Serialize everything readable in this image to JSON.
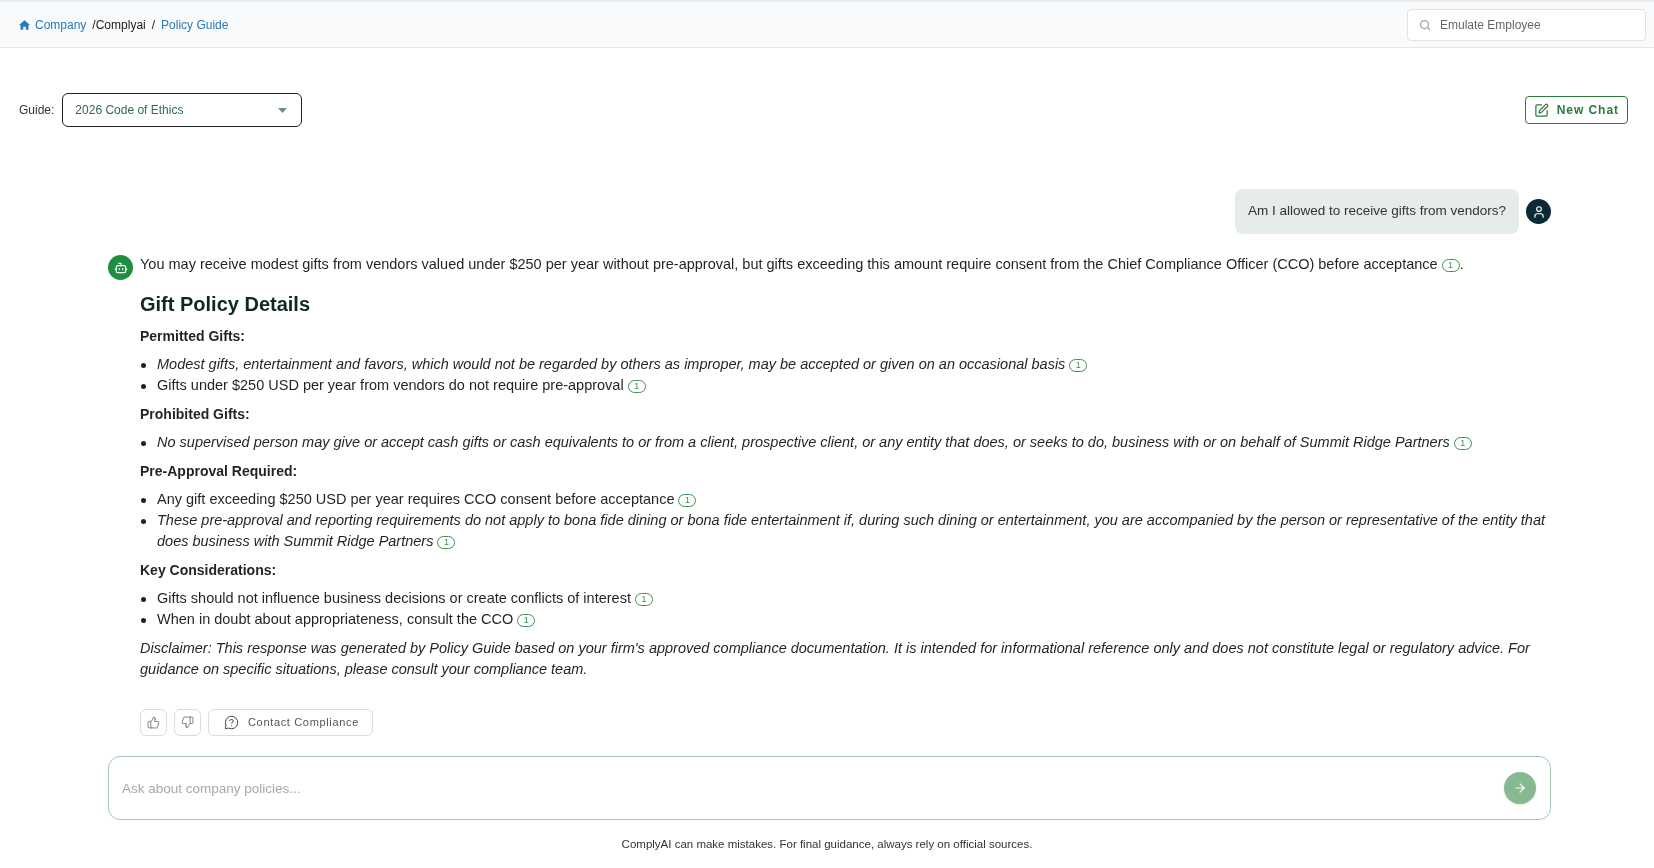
{
  "breadcrumb": [
    {
      "kind": "home",
      "label": "Company"
    },
    {
      "kind": "separator",
      "label": "/"
    },
    {
      "kind": "current",
      "label": "Complyai"
    },
    {
      "kind": "separator",
      "label": "/"
    },
    {
      "kind": "link",
      "label": "Policy Guide"
    }
  ],
  "search": {
    "placeholder": "Emulate Employee"
  },
  "guide": {
    "label": "Guide:",
    "value": "2026 Code of Ethics"
  },
  "new_chat_button": {
    "label": "New Chat"
  },
  "conversation": [
    {
      "kind": "user",
      "text": "Am I allowed to receive gifts from vendors?"
    },
    {
      "kind": "assistant",
      "summary": {
        "text": "You may receive modest gifts from vendors valued under $250 per year without pre-approval, but gifts exceeding this amount require consent from the Chief Compliance Officer (CCO) before acceptance",
        "citation": "1",
        "after": "."
      },
      "heading": "Gift Policy Details",
      "sections": [
        {
          "title": "Permitted Gifts:",
          "items": [
            {
              "text": "Modest gifts, entertainment and favors, which would not be regarded by others as improper, may be accepted or given on an occasional basis",
              "italic": true,
              "citation": "1"
            },
            {
              "text": "Gifts under $250 USD per year from vendors do not require pre-approval",
              "italic": false,
              "citation": "1"
            }
          ]
        },
        {
          "title": "Prohibited Gifts:",
          "items": [
            {
              "text": "No supervised person may give or accept cash gifts or cash equivalents to or from a client, prospective client, or any entity that does, or seeks to do, business with or on behalf of Summit Ridge Partners",
              "italic": true,
              "citation": "1"
            }
          ]
        },
        {
          "title": "Pre-Approval Required:",
          "items": [
            {
              "text": "Any gift exceeding $250 USD per year requires CCO consent before acceptance",
              "italic": false,
              "citation": "1"
            },
            {
              "text": "These pre-approval and reporting requirements do not apply to bona fide dining or bona fide entertainment if, during such dining or entertainment, you are accompanied by the person or representative of the entity that does business with Summit Ridge Partners",
              "italic": true,
              "citation": "1"
            }
          ]
        },
        {
          "title": "Key Considerations:",
          "items": [
            {
              "text": "Gifts should not influence business decisions or create conflicts of interest",
              "italic": false,
              "citation": "1"
            },
            {
              "text": "When in doubt about appropriateness, consult the CCO",
              "italic": false,
              "citation": "1"
            }
          ]
        }
      ],
      "disclaimer": "Disclaimer: This response was generated by Policy Guide based on your firm's approved compliance documentation. It is intended for informational reference only and does not constitute legal or regulatory advice. For guidance on specific situations, please consult your compliance team.",
      "actions": [
        {
          "kind": "like"
        },
        {
          "kind": "dislike"
        },
        {
          "kind": "contact",
          "label": "Contact Compliance"
        }
      ]
    }
  ],
  "composer": {
    "placeholder": "Ask about company policies...",
    "send_disabled": true
  },
  "footer": "ComplyAI can make mistakes. For final guidance, always rely on official sources."
}
